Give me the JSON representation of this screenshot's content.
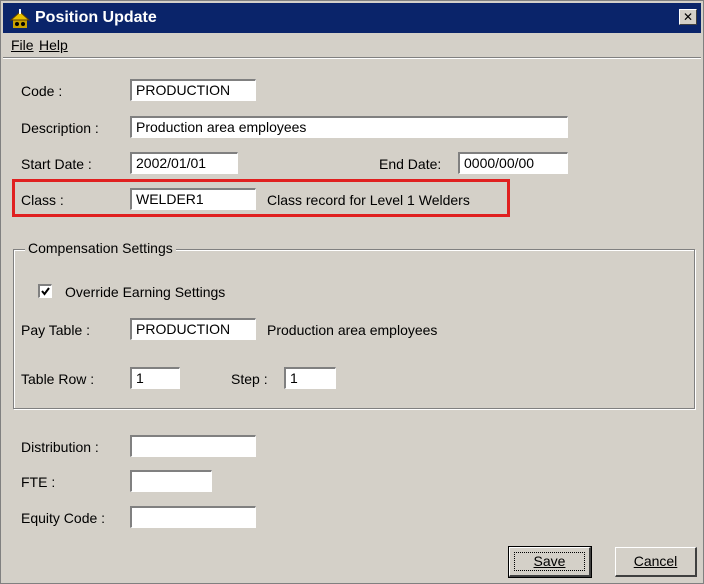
{
  "window": {
    "title": "Position Update",
    "close_glyph": "✕"
  },
  "menu": {
    "file": "File",
    "help": "Help"
  },
  "form": {
    "code_label": "Code :",
    "code_value": "PRODUCTION",
    "description_label": "Description :",
    "description_value": "Production area employees",
    "start_date_label": "Start Date :",
    "start_date_value": "2002/01/01",
    "end_date_label": "End Date:",
    "end_date_value": "0000/00/00",
    "class_label": "Class :",
    "class_value": "WELDER1",
    "class_description": "Class record for Level 1 Welders"
  },
  "compensation": {
    "group_title": "Compensation Settings",
    "override_label": "Override Earning Settings",
    "override_checked": true,
    "pay_table_label": "Pay Table :",
    "pay_table_value": "PRODUCTION",
    "pay_table_description": "Production area employees",
    "table_row_label": "Table Row :",
    "table_row_value": "1",
    "step_label": "Step :",
    "step_value": "1"
  },
  "extra": {
    "distribution_label": "Distribution :",
    "distribution_value": "",
    "fte_label": "FTE :",
    "fte_value": "",
    "equity_code_label": "Equity Code :",
    "equity_code_value": ""
  },
  "buttons": {
    "save": "Save",
    "cancel": "Cancel"
  },
  "colors": {
    "titlebar": "#0a246a",
    "face": "#d4d0c8",
    "highlight": "#e02020"
  }
}
